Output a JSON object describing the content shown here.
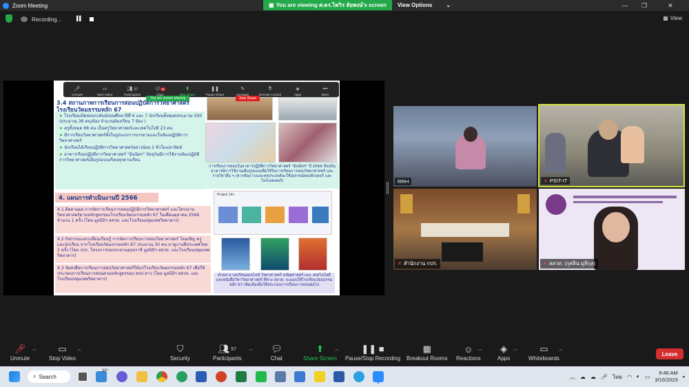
{
  "window": {
    "title": "Zoom Meeting"
  },
  "banner": {
    "viewing": "You are viewing ศ.ดร.ไพวิร ลัยพงษ์'s screen",
    "view_options": "View Options"
  },
  "recording": {
    "label": "Recording..."
  },
  "view_button": {
    "label": "View"
  },
  "share_toolbar": {
    "items": [
      {
        "label": "Unmute"
      },
      {
        "label": "Start Video"
      },
      {
        "label": "Participants",
        "count": "57"
      },
      {
        "label": "Chat",
        "badge": "30"
      },
      {
        "label": "New Share"
      },
      {
        "label": "Pause Share"
      },
      {
        "label": "Annotate"
      },
      {
        "label": "Remote Control"
      },
      {
        "label": "Apps"
      },
      {
        "label": "More"
      }
    ],
    "sharing_note": "You are screen sharing",
    "stop_share": "Stop Share"
  },
  "slide": {
    "section3_title_line1": "3.4 สถานภาพการเรียนการสอนปฏิบัติการวิทยาศาสตร์",
    "section3_title_line2": "โรงเรียนวัดมธรรมหลัก 67",
    "bullets": [
      "โรงเรียนเปิดสอนระดับมัธยมศึกษาปีที่ 6 และ 7 นักเรียนทั้งหมดประมาณ 500 (ประมาณ 36 คน/ห้อง จำนวนห้องเรียน 7 ห้อง )",
      "ครูทั้งหมด 68 คน เป็นครูวิทยาศาสตร์และเทคโนโลยี 23 คน",
      "มีการเรียนวิทยาศาสตร์ทั้งในรูปแบบการบรรยายและในห้องปฏิบัติการวิทยาศาสตร์",
      "นักเรียนได้เรียนปฏิบัติการวิทยาศาสตร์อย่างน้อย 2 ชั่วโมง/อาทิตย์",
      "อาคารเรียนปฏิบัติการวิทยาศาสตร์ \"มินนิตร\" ปัจจุบันมีการใช้งานห้องปฏิบัติการวิทยาศาสตร์เต็มรูปแบบเกือบทุกคาบเรียน"
    ],
    "photo_caption": "การเรียนการสอนในอาคารปฏิบัติการวิทยาศาสตร์ \"มินนิตร\" ปี 2566 ปัจจุบันอาคารมีการใช้งานเต็มรูปแบบเพื่อใช้ในการเรียนการสอนวิทยาศาสตร์ และรายวิชาอื่น ๆ (หากห้องว่างและครูประสงค์จะใช้อุปกรณ์คอมพิวเตอร์ และโปรเจคเตอร์)",
    "section4_title": "4. แผนการดำเนินงานปี 2566",
    "plans": [
      "4.1 ติดตามผล การจัดการเรียนการสอนปฏิบัติการวิทยาศาสตร์ และโครงงานวิทยาศาสตร์ตามหลักสูตรของโรงเรียนวัดมธรรมหลัก 67 ในเดือนตุลาคม 2566 จำนวน 1 ครั้ง (โดย มูลนิธิฯ สสวท. และโรงเรียนปทุมเทพวิทยาคาร)",
      "4.2 กิจกรรมแลกเปลี่ยนเรียนรู้ การจัดการเรียนการสอนวิทยาศาสตร์ โดยเชิญ ครู และนักเรียน จากโรงเรียนวัดมธรรมหลัก 67 ประมาณ 30 คน มาดูงานที่ประเทศไทย 1 ครั้ง (โดย กปร. โครงการขอประทานดุลยราชิ มูลนิธิฯ สสวท. และโรงเรียนปทุมเทพวิทยาคาร)",
      "4.3 จัดส่งสื่อการเรียนการสอนวิทยาศาสตร์ให้แก่โรงเรียนวัดมธรรมหลัก 67 เพื่อใช้ประกอบการเรียนการสอนตามหลักสูตรของ สปป.ลาว (โดย มูลนิธิฯ สสวท. และโรงเรียนปทุมเทพวิทยาคาร)"
    ],
    "book_caption": "ตัวอย่าง บทเรียนออนไลน์ วิทยาศาสตร์ คณิตศาสตร์ และ เทคโนโลยี และหนังสือวิชาวิทยาศาสตร์ ที่ทาง สสวท. จะมอบให้โรงเรียนวัดมธรรมหลัก 67 เพิ่มเติมเพื่อใช้ประกอบการเรียนการสอนต่อไป",
    "website_label": "Project 14+"
  },
  "participants": [
    {
      "name": "RRH",
      "muted": false
    },
    {
      "name": "PSIT-IT",
      "muted": true
    },
    {
      "name": "สำนักงาน กปร.",
      "muted": true
    },
    {
      "name": "สสวท. (กุศลิน มุสิกุล)",
      "muted": true
    }
  ],
  "toolbar": {
    "unmute": "Unmute",
    "stop_video": "Stop Video",
    "security": "Security",
    "participants": "Participants",
    "participants_count": "57",
    "chat": "Chat",
    "share_screen": "Share Screen",
    "pause_stop_recording": "Pause/Stop Recording",
    "breakout_rooms": "Breakout Rooms",
    "reactions": "Reactions",
    "apps": "Apps",
    "whiteboards": "Whiteboards",
    "leave": "Leave"
  },
  "taskbar": {
    "search": "Search",
    "weather_temp": "30°",
    "language": "ไทย",
    "time": "9:46 AM",
    "date": "3/16/2023"
  },
  "colors": {
    "accent_green": "#23c552",
    "leave_red": "#d32f2f",
    "active_border": "#d6e341"
  }
}
